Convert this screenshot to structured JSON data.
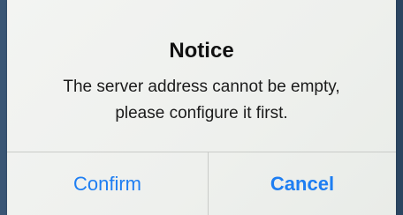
{
  "dialog": {
    "title": "Notice",
    "message_line1": "The server address cannot be empty,",
    "message_line2": "please configure it first.",
    "buttons": {
      "confirm": "Confirm",
      "cancel": "Cancel"
    }
  },
  "colors": {
    "button_text": "#1e7ef2",
    "dialog_background": "#eef0ed",
    "divider": "#c9cbc8"
  }
}
